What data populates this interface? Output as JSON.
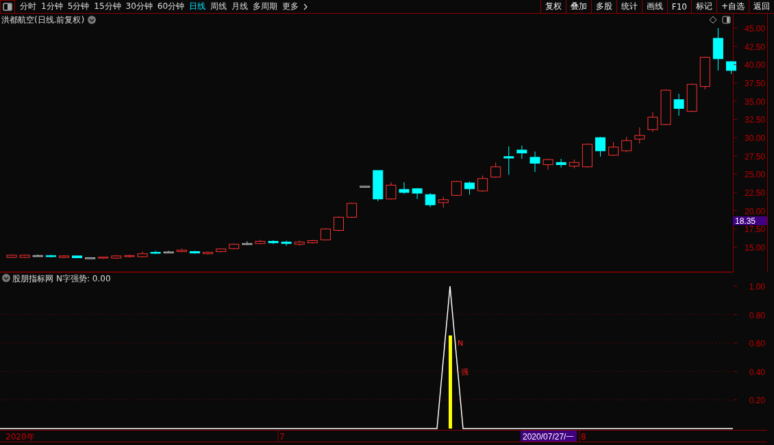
{
  "toolbar": {
    "periods": [
      {
        "label": "分时",
        "selected": false
      },
      {
        "label": "1分钟",
        "selected": false
      },
      {
        "label": "5分钟",
        "selected": false
      },
      {
        "label": "15分钟",
        "selected": false
      },
      {
        "label": "30分钟",
        "selected": false
      },
      {
        "label": "60分钟",
        "selected": false
      },
      {
        "label": "日线",
        "selected": true
      },
      {
        "label": "周线",
        "selected": false
      },
      {
        "label": "月线",
        "selected": false
      },
      {
        "label": "多周期",
        "selected": false
      },
      {
        "label": "更多",
        "selected": false
      }
    ],
    "actions": [
      "复权",
      "叠加",
      "多股",
      "统计",
      "画线",
      "F10",
      "标记",
      "+自选",
      "返回"
    ]
  },
  "main_chart": {
    "title": "洪都航空(日线.前复权)",
    "price_tag": "18.35",
    "chart_data": {
      "type": "candlestick",
      "ylim": [
        11.63,
        46.97
      ],
      "yticks": [
        {
          "value": 45,
          "label": "45.00"
        },
        {
          "value": 42.5,
          "label": "42.50"
        },
        {
          "value": 40,
          "label": "40.00"
        },
        {
          "value": 37.5,
          "label": "37.50"
        },
        {
          "value": 35,
          "label": "35.00"
        },
        {
          "value": 32.5,
          "label": "32.50"
        },
        {
          "value": 30,
          "label": "30.00"
        },
        {
          "value": 27.5,
          "label": "27.50"
        },
        {
          "value": 25,
          "label": "25.00"
        },
        {
          "value": 22.5,
          "label": "22.50"
        },
        {
          "value": 20,
          "label": "20.00"
        },
        {
          "value": 17.5,
          "label": "17.50"
        },
        {
          "value": 15,
          "label": "15.00"
        }
      ],
      "ohlc": [
        [
          13.6,
          14,
          13.5,
          13.9
        ],
        [
          13.6,
          14,
          13.5,
          13.9
        ],
        [
          13.8,
          14,
          13.7,
          13.85
        ],
        [
          13.85,
          13.95,
          13.6,
          13.7
        ],
        [
          13.6,
          13.9,
          13.5,
          13.8
        ],
        [
          13.8,
          13.85,
          13.5,
          13.55
        ],
        [
          13.5,
          13.6,
          13.4,
          13.55
        ],
        [
          13.5,
          13.7,
          13.4,
          13.65
        ],
        [
          13.5,
          13.9,
          13.4,
          13.8
        ],
        [
          13.75,
          13.95,
          13.6,
          13.85
        ],
        [
          13.7,
          14.4,
          13.6,
          14.1
        ],
        [
          14.3,
          14.5,
          14.1,
          14.2
        ],
        [
          14.3,
          14.5,
          14.2,
          14.35
        ],
        [
          14.4,
          14.8,
          14.3,
          14.6
        ],
        [
          14.4,
          14.5,
          14.1,
          14.2
        ],
        [
          14.1,
          14.4,
          14,
          14.3
        ],
        [
          14.4,
          14.8,
          14.3,
          14.75
        ],
        [
          14.8,
          15.5,
          14.7,
          15.4
        ],
        [
          15.5,
          15.8,
          15.3,
          15.45
        ],
        [
          15.5,
          16,
          15.4,
          15.8
        ],
        [
          15.8,
          15.95,
          15.4,
          15.6
        ],
        [
          15.7,
          15.9,
          15.2,
          15.5
        ],
        [
          15.4,
          15.9,
          15.2,
          15.7
        ],
        [
          15.6,
          16,
          15.5,
          15.9
        ],
        [
          16,
          17.6,
          15.9,
          17.5
        ],
        [
          17.3,
          19.2,
          17.2,
          19.1
        ],
        [
          19.1,
          21.1,
          19,
          21
        ],
        [
          23.3,
          23.4,
          23.2,
          23.35
        ],
        [
          25.5,
          25.5,
          21.3,
          21.6
        ],
        [
          21.6,
          23.9,
          21.5,
          23.5
        ],
        [
          22.9,
          23.9,
          22.3,
          22.5
        ],
        [
          23,
          23.1,
          21.6,
          22.4
        ],
        [
          22.2,
          22.4,
          20.5,
          20.8
        ],
        [
          21.1,
          21.9,
          20.4,
          21.5
        ],
        [
          22.1,
          24.1,
          22,
          24
        ],
        [
          23.8,
          24,
          22.2,
          23
        ],
        [
          22.7,
          24.8,
          22.6,
          24.4
        ],
        [
          24.6,
          26.6,
          24.5,
          26
        ],
        [
          27.4,
          28.8,
          24.9,
          27.2
        ],
        [
          28.3,
          28.9,
          27.1,
          27.9
        ],
        [
          27.3,
          28.1,
          25.3,
          26.5
        ],
        [
          26.3,
          27.1,
          25.6,
          27
        ],
        [
          26.6,
          27.1,
          25.9,
          26.3
        ],
        [
          26.1,
          27,
          25.8,
          26.6
        ],
        [
          26,
          29.2,
          25.9,
          29.1
        ],
        [
          30,
          30.1,
          27.4,
          28.2
        ],
        [
          27.6,
          29.4,
          27.5,
          28.7
        ],
        [
          28.2,
          30.1,
          28,
          29.6
        ],
        [
          29.8,
          31.4,
          29.2,
          30.3
        ],
        [
          31.1,
          33.5,
          30.8,
          32.8
        ],
        [
          31.8,
          36.6,
          31.7,
          36.5
        ],
        [
          35.2,
          36,
          33,
          34
        ],
        [
          33.6,
          37.4,
          33.5,
          37.3
        ],
        [
          37,
          41.1,
          36.6,
          41
        ],
        [
          43.6,
          45,
          39.2,
          40.8
        ],
        [
          40.4,
          40.5,
          38.7,
          39.2
        ]
      ]
    }
  },
  "indicator": {
    "source": "股朋指标网",
    "formula": "N字强势: 0.00",
    "signal_labels": [
      "N",
      "强"
    ],
    "y_axis": [
      "1.00",
      "0.80",
      "0.60",
      "0.40",
      "0.20"
    ]
  },
  "date_axis": {
    "labels": [
      "2020年",
      "7",
      "8"
    ],
    "cursor_date": "2020/07/27/一"
  }
}
